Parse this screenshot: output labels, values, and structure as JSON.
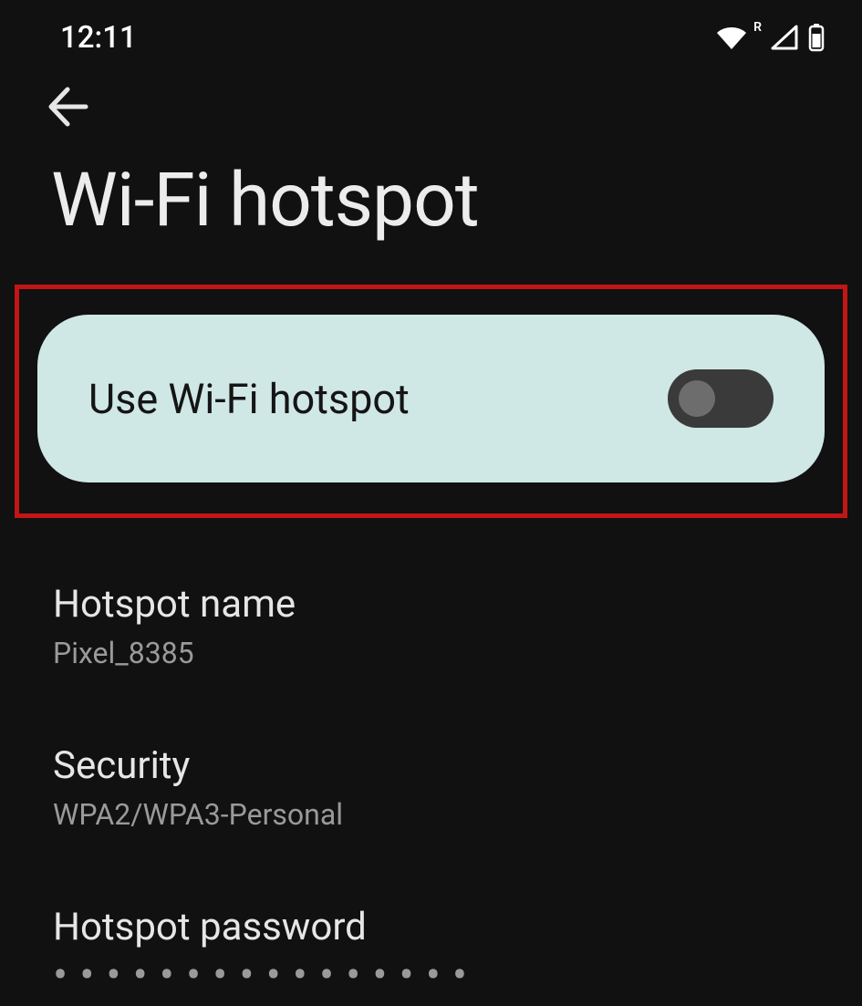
{
  "statusbar": {
    "time": "12:11",
    "roaming_indicator": "R"
  },
  "header": {
    "title": "Wi-Fi hotspot"
  },
  "toggle": {
    "label": "Use Wi-Fi hotspot",
    "enabled": false
  },
  "settings": {
    "name": {
      "title": "Hotspot name",
      "value": "Pixel_8385"
    },
    "security": {
      "title": "Security",
      "value": "WPA2/WPA3-Personal"
    },
    "password": {
      "title": "Hotspot password",
      "masked": "••••••••••••••••"
    }
  }
}
